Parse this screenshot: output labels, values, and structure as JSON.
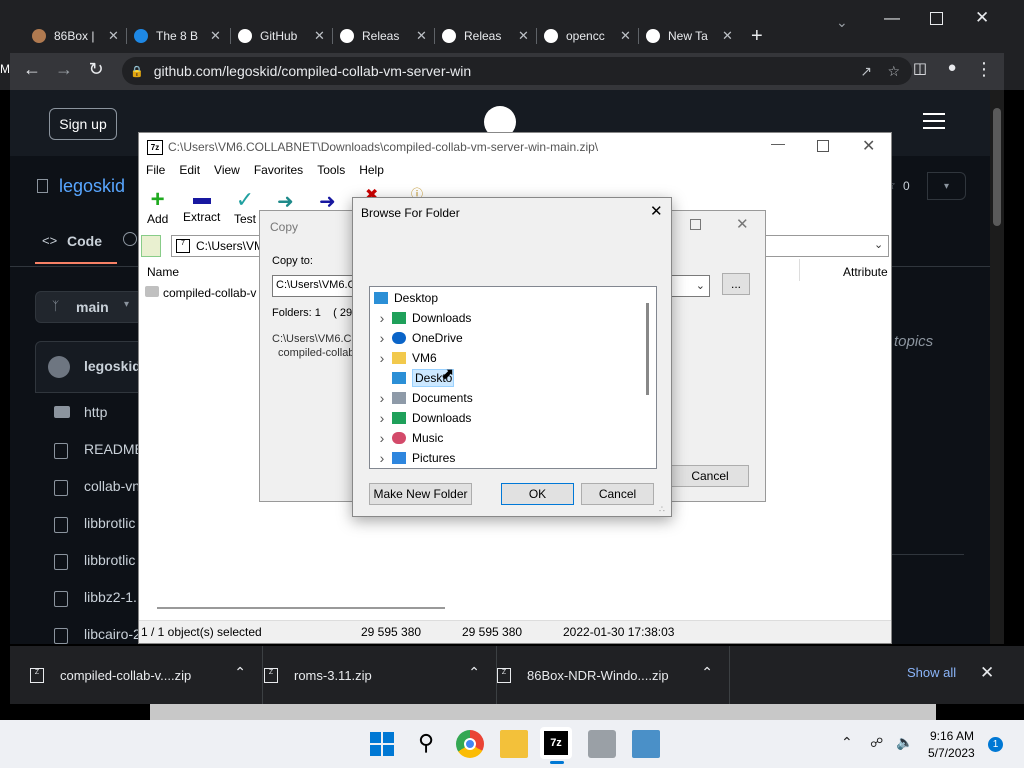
{
  "browser": {
    "tabs": [
      {
        "label": "86Box |"
      },
      {
        "label": "The 8 B"
      },
      {
        "label": "GitHub"
      },
      {
        "label": "Releas"
      },
      {
        "label": "Releas"
      },
      {
        "label": "opencc"
      },
      {
        "label": "New Ta"
      }
    ],
    "new_tab": "+",
    "url": "github.com/legoskid/compiled-collab-vm-server-win"
  },
  "github": {
    "sign_up": "Sign up",
    "owner": "legoskid",
    "code_tab": "Code",
    "branch": "main",
    "star_count": "0",
    "topics_text": "topics",
    "commit_author": "legoskid",
    "files": [
      "http",
      "README",
      "collab-vn",
      "libbrotlic",
      "libbrotlic",
      "libbz2-1.",
      "libcairo-2"
    ]
  },
  "sevenzip": {
    "title": "C:\\Users\\VM6.COLLABNET\\Downloads\\compiled-collab-vm-server-win-main.zip\\",
    "menu": [
      "File",
      "Edit",
      "View",
      "Favorites",
      "Tools",
      "Help"
    ],
    "toolbar": {
      "add": "Add",
      "extract": "Extract",
      "test": "Test"
    },
    "path": "C:\\Users\\VM",
    "col_name": "Name",
    "col_attributes": "Attribute",
    "row_name": "compiled-collab-v",
    "status": {
      "selected": "1 / 1 object(s) selected",
      "size": "29 595 380",
      "packed": "29 595 380",
      "modified": "2022-01-30 17:38:03"
    }
  },
  "copy_dialog": {
    "title": "Copy",
    "copy_to_label": "Copy to:",
    "copy_to_value": "C:\\Users\\VM6.C",
    "browse_btn": "...",
    "folders": "Folders: 1    ( 29 5",
    "path_line1": "C:\\Users\\VM6.C",
    "path_line2": "compiled-collab-",
    "cancel": "Cancel"
  },
  "browse_dialog": {
    "title": "Browse For Folder",
    "tree": [
      {
        "label": "Desktop",
        "icon": "desktop-icon",
        "level": 0,
        "chevron": false
      },
      {
        "label": "Downloads",
        "icon": "download-icon",
        "level": 1,
        "chevron": true
      },
      {
        "label": "OneDrive",
        "icon": "cloud-icon",
        "level": 1,
        "chevron": true
      },
      {
        "label": "VM6",
        "icon": "folder-icon",
        "level": 1,
        "chevron": true
      },
      {
        "label": "Desktop",
        "icon": "desktop-icon",
        "level": 1,
        "chevron": false,
        "selected": true
      },
      {
        "label": "Documents",
        "icon": "document-icon",
        "level": 1,
        "chevron": true
      },
      {
        "label": "Downloads",
        "icon": "download-icon",
        "level": 1,
        "chevron": true
      },
      {
        "label": "Music",
        "icon": "music-icon",
        "level": 1,
        "chevron": true
      },
      {
        "label": "Pictures",
        "icon": "picture-icon",
        "level": 1,
        "chevron": true
      }
    ],
    "make_new_folder": "Make New Folder",
    "ok": "OK",
    "cancel": "Cancel"
  },
  "downloads": {
    "items": [
      "compiled-collab-v....zip",
      "roms-3.11.zip",
      "86Box-NDR-Windo....zip"
    ],
    "show_all": "Show all"
  },
  "taskbar": {
    "time": "9:16 AM",
    "date": "5/7/2023",
    "notification_count": "1"
  }
}
